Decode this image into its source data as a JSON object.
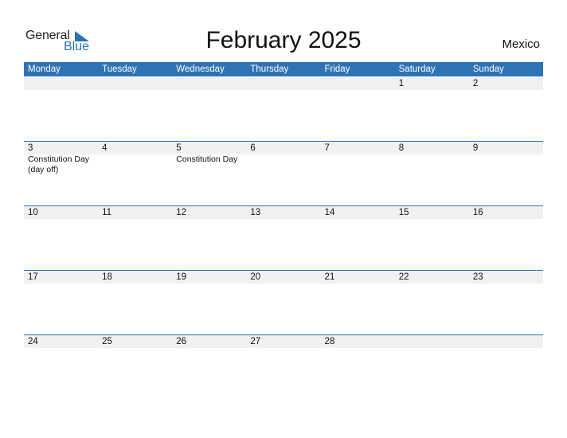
{
  "logo": {
    "general": "General",
    "blue": "Blue"
  },
  "title": "February 2025",
  "country": "Mexico",
  "colors": {
    "accent": "#2e73b5",
    "band": "#f1f1f1"
  },
  "weekdays": [
    "Monday",
    "Tuesday",
    "Wednesday",
    "Thursday",
    "Friday",
    "Saturday",
    "Sunday"
  ],
  "weeks": [
    [
      {
        "num": ""
      },
      {
        "num": ""
      },
      {
        "num": ""
      },
      {
        "num": ""
      },
      {
        "num": ""
      },
      {
        "num": "1"
      },
      {
        "num": "2"
      }
    ],
    [
      {
        "num": "3",
        "event": "Constitution Day (day off)"
      },
      {
        "num": "4"
      },
      {
        "num": "5",
        "event": "Constitution Day"
      },
      {
        "num": "6"
      },
      {
        "num": "7"
      },
      {
        "num": "8"
      },
      {
        "num": "9"
      }
    ],
    [
      {
        "num": "10"
      },
      {
        "num": "11"
      },
      {
        "num": "12"
      },
      {
        "num": "13"
      },
      {
        "num": "14"
      },
      {
        "num": "15"
      },
      {
        "num": "16"
      }
    ],
    [
      {
        "num": "17"
      },
      {
        "num": "18"
      },
      {
        "num": "19"
      },
      {
        "num": "20"
      },
      {
        "num": "21"
      },
      {
        "num": "22"
      },
      {
        "num": "23"
      }
    ],
    [
      {
        "num": "24"
      },
      {
        "num": "25"
      },
      {
        "num": "26"
      },
      {
        "num": "27"
      },
      {
        "num": "28"
      },
      {
        "num": ""
      },
      {
        "num": ""
      }
    ]
  ]
}
